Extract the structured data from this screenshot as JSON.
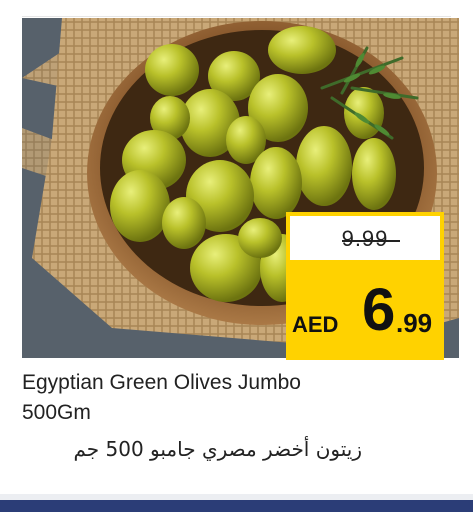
{
  "product": {
    "image_alt": "Egyptian Green Olives",
    "old_price": "9.99",
    "currency": "AED",
    "price_integer": "6",
    "price_decimal": ".99",
    "title_en_line1": "Egyptian Green Olives Jumbo",
    "title_en_line2": "500Gm",
    "title_ar": "زيتون أخضر مصري جامبو 500 جم"
  },
  "colors": {
    "price_badge": "#ffd200",
    "bottom_bar": "#2b3d77"
  },
  "icons": {
    "product_image": "olives-bowl-photo"
  }
}
